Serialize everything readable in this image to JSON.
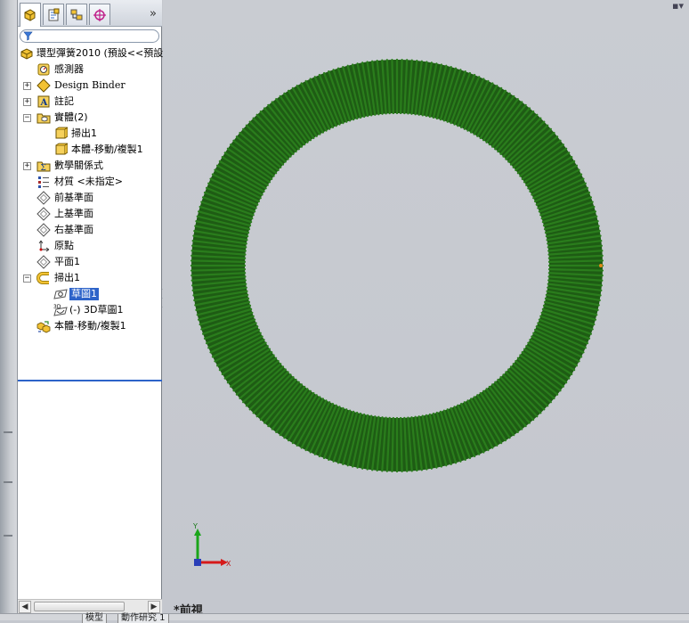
{
  "feature_manager": {
    "tabs": [
      {
        "name": "featuremanager-tab",
        "icon": "feature-tree-icon"
      },
      {
        "name": "propertymanager-tab",
        "icon": "property-manager-icon"
      },
      {
        "name": "configurationmanager-tab",
        "icon": "configuration-manager-icon"
      },
      {
        "name": "dimxpert-tab",
        "icon": "dimxpert-crosshair-icon"
      }
    ],
    "more_label": "»",
    "filter_placeholder": "",
    "tree": {
      "root": "環型彈簧2010  (預設<<預設",
      "sensors": "感測器",
      "design_binder": "Design Binder",
      "annotations": "註記",
      "solid_bodies": "實體(2)",
      "body_sweep": "掃出1",
      "body_move_copy": "本體-移動/複製1",
      "equations": "數學關係式",
      "material": "材質 <未指定>",
      "front_plane": "前基準面",
      "top_plane": "上基準面",
      "right_plane": "右基準面",
      "origin": "原點",
      "plane1": "平面1",
      "sweep1": "掃出1",
      "sketch1": "草圖1",
      "sketch3d": "(-) 3D草圖1",
      "move_copy1": "本體-移動/複製1"
    }
  },
  "viewport": {
    "view_name": "*前視",
    "triad": {
      "y_label": "Y",
      "x_label": "X"
    },
    "coil_color": "#2a7d1c"
  },
  "bottom_tabs": [
    "模型",
    "動作研究 1"
  ]
}
